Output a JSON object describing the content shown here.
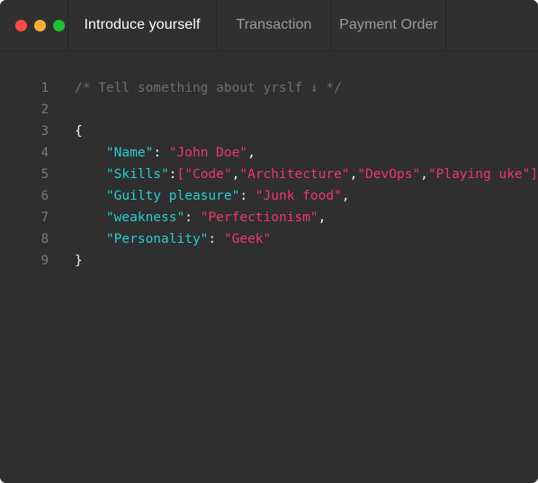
{
  "window": {
    "background": "#2f2f2f",
    "titlebar_background": "#303030"
  },
  "titlebar": {
    "traffic_lights": [
      {
        "name": "close",
        "color": "#fc4b45"
      },
      {
        "name": "minimize",
        "color": "#f9ae3c"
      },
      {
        "name": "zoom",
        "color": "#1ec132"
      }
    ],
    "tabs": [
      {
        "label": "Introduce yourself",
        "active": true
      },
      {
        "label": "Transaction",
        "active": false
      },
      {
        "label": "Payment Order",
        "active": false
      }
    ]
  },
  "editor": {
    "colors": {
      "comment": "#6f6f6f",
      "key": "#25cfd4",
      "string": "#f0386b",
      "punctuation": "#f4f4f4",
      "line_number": "#7b7b7b"
    },
    "lines": [
      {
        "number": "1",
        "text": "/* Tell something about yrslf ↓ */"
      },
      {
        "number": "2",
        "text": ""
      },
      {
        "number": "3",
        "text": "{"
      },
      {
        "number": "4",
        "text": "    \"Name\": \"John Doe\","
      },
      {
        "number": "5",
        "text": "    \"Skills\":[\"Code\",\"Architecture\",\"DevOps\",\"Playing uke\"],"
      },
      {
        "number": "6",
        "text": "    \"Guilty pleasure\": \"Junk food\","
      },
      {
        "number": "7",
        "text": "    \"weakness\": \"Perfectionism\","
      },
      {
        "number": "8",
        "text": "    \"Personality\": \"Geek\""
      },
      {
        "number": "9",
        "text": "}"
      }
    ],
    "tokens": [
      [
        {
          "t": "/* Tell something about yrslf ↓ */",
          "c": "comment"
        }
      ],
      [],
      [
        {
          "t": "{",
          "c": "punct"
        }
      ],
      [
        {
          "t": "    ",
          "c": "punct"
        },
        {
          "t": "\"Name\"",
          "c": "key"
        },
        {
          "t": ": ",
          "c": "colon"
        },
        {
          "t": "\"John Doe\"",
          "c": "string"
        },
        {
          "t": ",",
          "c": "comma"
        }
      ],
      [
        {
          "t": "    ",
          "c": "punct"
        },
        {
          "t": "\"Skills\"",
          "c": "key"
        },
        {
          "t": ":",
          "c": "colon"
        },
        {
          "t": "[",
          "c": "bracket"
        },
        {
          "t": "\"Code\"",
          "c": "string"
        },
        {
          "t": ",",
          "c": "comma"
        },
        {
          "t": "\"Architecture\"",
          "c": "string"
        },
        {
          "t": ",",
          "c": "comma"
        },
        {
          "t": "\"DevOps\"",
          "c": "string"
        },
        {
          "t": ",",
          "c": "comma"
        },
        {
          "t": "\"Playing uke\"",
          "c": "string"
        },
        {
          "t": "]",
          "c": "bracket"
        },
        {
          "t": ",",
          "c": "comma"
        }
      ],
      [
        {
          "t": "    ",
          "c": "punct"
        },
        {
          "t": "\"Guilty pleasure\"",
          "c": "key"
        },
        {
          "t": ": ",
          "c": "colon"
        },
        {
          "t": "\"Junk food\"",
          "c": "string"
        },
        {
          "t": ",",
          "c": "comma"
        }
      ],
      [
        {
          "t": "    ",
          "c": "punct"
        },
        {
          "t": "\"weakness\"",
          "c": "key"
        },
        {
          "t": ": ",
          "c": "colon"
        },
        {
          "t": "\"Perfectionism\"",
          "c": "string"
        },
        {
          "t": ",",
          "c": "comma"
        }
      ],
      [
        {
          "t": "    ",
          "c": "punct"
        },
        {
          "t": "\"Personality\"",
          "c": "key"
        },
        {
          "t": ": ",
          "c": "colon"
        },
        {
          "t": "\"Geek\"",
          "c": "string"
        }
      ],
      [
        {
          "t": "}",
          "c": "punct"
        }
      ]
    ]
  }
}
